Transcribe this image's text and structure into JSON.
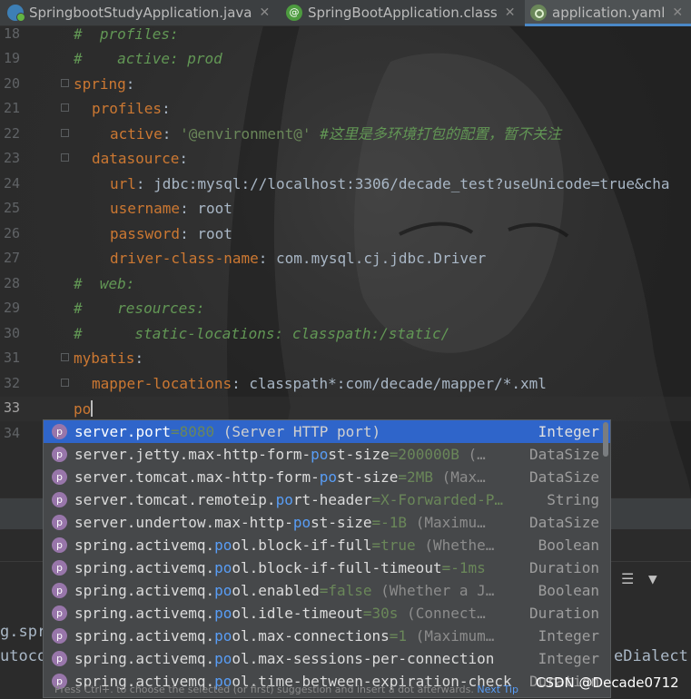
{
  "tabs": [
    {
      "label": "SpringbootStudyApplication.java",
      "icon": "java-class-icon",
      "close": "✕"
    },
    {
      "label": "SpringBootApplication.class",
      "icon": "annotation-class-icon",
      "close": "✕"
    },
    {
      "label": "application.yaml",
      "icon": "yaml-file-icon",
      "close": "✕",
      "active": true
    }
  ],
  "editor": {
    "line_numbers": [
      "18",
      "19",
      "20",
      "21",
      "22",
      "23",
      "24",
      "25",
      "26",
      "27",
      "28",
      "29",
      "30",
      "31",
      "32",
      "33",
      "34"
    ],
    "lines": {
      "l18": "#  profiles:",
      "l19": "#    active: prod",
      "l20_key": "spring",
      "l21_key": "profiles",
      "l22_key": "active",
      "l22_val": "'@environment@'",
      "l22_comment": "#这里是多环境打包的配置，暂不关注",
      "l23_key": "datasource",
      "l24_key": "url",
      "l24_val": "jdbc:mysql://localhost:3306/decade_test?useUnicode=true&cha",
      "l25_key": "username",
      "l25_val": "root",
      "l26_key": "password",
      "l26_val": "root",
      "l27_key": "driver-class-name",
      "l27_val": "com.mysql.cj.jdbc.Driver",
      "l28": "#  web:",
      "l29": "#    resources:",
      "l30": "#      static-locations: classpath:/static/",
      "l31_key": "mybatis",
      "l32_key": "mapper-locations",
      "l32_val": "classpath*:com/decade/mapper/*.xml",
      "l33_typed": "po"
    }
  },
  "completion": {
    "items": [
      {
        "pre": "server.",
        "hl": "port",
        "post": "",
        "val": "=8080",
        "desc": " (Server HTTP port)",
        "type": "Integer",
        "selected": true
      },
      {
        "pre": "server.jetty.max-http-form-",
        "hl": "po",
        "post": "st-size",
        "val": "=200000B",
        "desc": " (…",
        "type": "DataSize"
      },
      {
        "pre": "server.tomcat.max-http-form-",
        "hl": "po",
        "post": "st-size",
        "val": "=2MB",
        "desc": " (Max…",
        "type": "DataSize"
      },
      {
        "pre": "server.tomcat.remoteip.",
        "hl": "po",
        "post": "rt-header",
        "val": "=X-Forwarded-P…",
        "desc": "",
        "type": "String"
      },
      {
        "pre": "server.undertow.max-http-",
        "hl": "po",
        "post": "st-size",
        "val": "=-1B",
        "desc": " (Maximu…",
        "type": "DataSize"
      },
      {
        "pre": "spring.activemq.",
        "hl": "po",
        "post": "ol.block-if-full",
        "val": "=true",
        "desc": " (Whethe…",
        "type": "Boolean"
      },
      {
        "pre": "spring.activemq.",
        "hl": "po",
        "post": "ol.block-if-full-timeout",
        "val": "=-1ms",
        "desc": "",
        "type": "Duration"
      },
      {
        "pre": "spring.activemq.",
        "hl": "po",
        "post": "ol.enabled",
        "val": "=false",
        "desc": " (Whether a J…",
        "type": "Boolean"
      },
      {
        "pre": "spring.activemq.",
        "hl": "po",
        "post": "ol.idle-timeout",
        "val": "=30s",
        "desc": " (Connect…",
        "type": "Duration"
      },
      {
        "pre": "spring.activemq.",
        "hl": "po",
        "post": "ol.max-connections",
        "val": "=1",
        "desc": " (Maximum…",
        "type": "Integer"
      },
      {
        "pre": "spring.activemq.",
        "hl": "po",
        "post": "ol.max-sessions-per-connection",
        "val": "",
        "desc": "",
        "type": "Integer"
      },
      {
        "pre": "spring.activemq.",
        "hl": "po",
        "post": "ol.time-between-expiration-check",
        "val": "",
        "desc": "",
        "type": "Duration"
      }
    ],
    "item_icon": "property-icon",
    "item_icon_glyph": "p",
    "hint_text": "Press Ctrl+. to choose the selected (or first) suggestion and insert a dot afterwards.",
    "hint_link": "Next Tip"
  },
  "background_panel": {
    "left_text_1": "g.spri",
    "left_text_2": "utoco",
    "right_text": "eDialect",
    "icons": [
      "sort-icon",
      "filter-icon"
    ]
  },
  "watermark": "CSDN @Decade0712",
  "colors": {
    "accent": "#2f65ca",
    "keyword": "#cc7832",
    "comment": "#629755",
    "string": "#6a8759"
  }
}
